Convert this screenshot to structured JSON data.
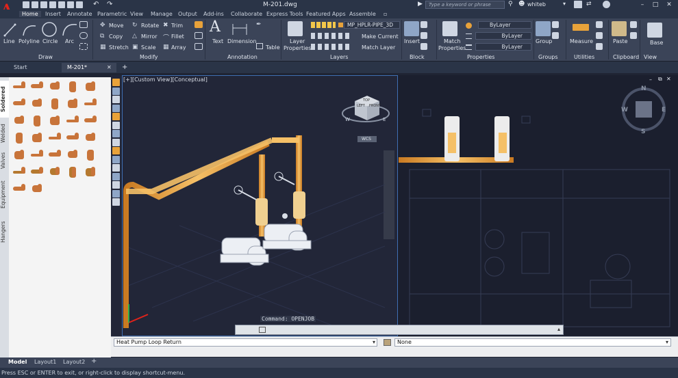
{
  "app": {
    "title": "M-201.dwg",
    "logo_letter": "A"
  },
  "search": {
    "placeholder": "Type a keyword or phrase"
  },
  "user": {
    "name": "whiteb"
  },
  "ribbon_tabs": [
    "Home",
    "Insert",
    "Annotate",
    "Parametric",
    "View",
    "Manage",
    "Output",
    "Add-ins",
    "Collaborate",
    "Express Tools",
    "Featured Apps",
    "Assemble"
  ],
  "ribbon": {
    "draw": {
      "title": "Draw",
      "line": "Line",
      "polyline": "Polyline",
      "circle": "Circle",
      "arc": "Arc"
    },
    "modify": {
      "title": "Modify",
      "move": "Move",
      "rotate": "Rotate",
      "trim": "Trim",
      "copy": "Copy",
      "mirror": "Mirror",
      "fillet": "Fillet",
      "stretch": "Stretch",
      "scale": "Scale",
      "array": "Array"
    },
    "annotation": {
      "title": "Annotation",
      "text": "Text",
      "dimension": "Dimension",
      "table": "Table"
    },
    "layers": {
      "title": "Layers",
      "layer_properties_1": "Layer",
      "layer_properties_2": "Properties",
      "current_layer": "MP_HPLR-PIPE_3D",
      "make_current": "Make Current",
      "match_layer": "Match Layer"
    },
    "block": {
      "title": "Block",
      "insert": "Insert"
    },
    "properties": {
      "title": "Properties",
      "match_1": "Match",
      "match_2": "Properties",
      "color": "ByLayer",
      "linetype": "ByLayer",
      "lineweight": "ByLayer"
    },
    "groups": {
      "title": "Groups",
      "group": "Group"
    },
    "utilities": {
      "title": "Utilities",
      "measure": "Measure"
    },
    "clipboard": {
      "title": "Clipboard",
      "paste": "Paste"
    },
    "view": {
      "title": "View",
      "base": "Base"
    }
  },
  "file_tabs": [
    "Start",
    "M-201*"
  ],
  "palette": {
    "tabs": [
      "Soldered",
      "Welded",
      "Valves",
      "Equipment",
      "Hangers"
    ],
    "active": "Soldered"
  },
  "viewport": {
    "label": "[+][Custom View][Conceptual]",
    "compass": {
      "n": "N",
      "s": "S",
      "w": "W",
      "e": "E"
    },
    "wcs": "WCS",
    "cube_faces": {
      "top": "TOP",
      "front": "FRONT",
      "left": "LEFT"
    }
  },
  "command": {
    "last": "Command: OPENJOB",
    "placeholder": ""
  },
  "properties_strip": {
    "layer": "Heat Pump Loop Return",
    "value": "None"
  },
  "layout_tabs": [
    "Model",
    "Layout1",
    "Layout2"
  ],
  "status": {
    "message": "Press ESC or ENTER to exit, or right-click to display shortcut-menu."
  },
  "colors": {
    "accent": "#e2231a",
    "pipe": "#e8a23a",
    "ribbon": "#3b4458",
    "background": "#222638"
  }
}
